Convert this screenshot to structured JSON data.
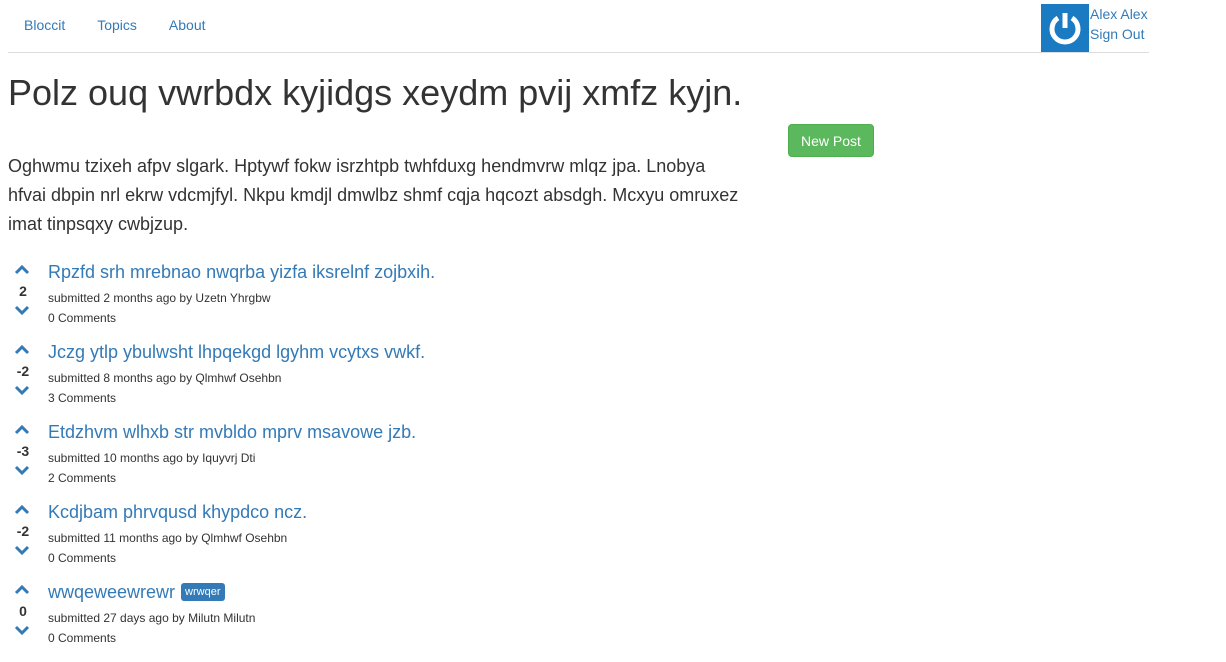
{
  "nav": {
    "brand": "Bloccit",
    "topics": "Topics",
    "about": "About",
    "user_name": "Alex Alex",
    "sign_out": "Sign Out"
  },
  "topic": {
    "title": "Polz ouq vwrbdx kyjidgs xeydm pvij xmfz kyjn.",
    "description": "Oghwmu tzixeh afpv slgark. Hptywf fokw isrzhtpb twhfduxg hendmvrw mlqz jpa. Lnobya hfvai dbpin nrl ekrw vdcmjfyl. Nkpu kmdjl dmwlbz shmf cqja hqcozt absdgh. Mcxyu omruxez imat tinpsqxy cwbjzup.",
    "new_post_label": "New Post"
  },
  "posts": [
    {
      "votes": "2",
      "title": "Rpzfd srh mrebnao nwqrba yizfa iksrelnf zojbxih.",
      "label": "",
      "meta": "submitted 2 months ago by Uzetn Yhrgbw",
      "comments": "0 Comments"
    },
    {
      "votes": "-2",
      "title": "Jczg ytlp ybulwsht lhpqekgd lgyhm vcytxs vwkf.",
      "label": "",
      "meta": "submitted 8 months ago by Qlmhwf Osehbn",
      "comments": "3 Comments"
    },
    {
      "votes": "-3",
      "title": "Etdzhvm wlhxb str mvbldo mprv msavowe jzb.",
      "label": "",
      "meta": "submitted 10 months ago by Iquyvrj Dti",
      "comments": "2 Comments"
    },
    {
      "votes": "-2",
      "title": "Kcdjbam phrvqusd khypdco ncz.",
      "label": "",
      "meta": "submitted 11 months ago by Qlmhwf Osehbn",
      "comments": "0 Comments"
    },
    {
      "votes": "0",
      "title": "wwqeweewrewr",
      "label": "wrwqer",
      "meta": "submitted 27 days ago by Milutn Milutn",
      "comments": "0 Comments"
    }
  ],
  "colors": {
    "link": "#337ab7",
    "success": "#5cb85c",
    "avatar": "#1a7ac2"
  },
  "icons": {
    "avatar": "power-icon",
    "vote_up": "chevron-up-icon",
    "vote_down": "chevron-down-icon"
  }
}
